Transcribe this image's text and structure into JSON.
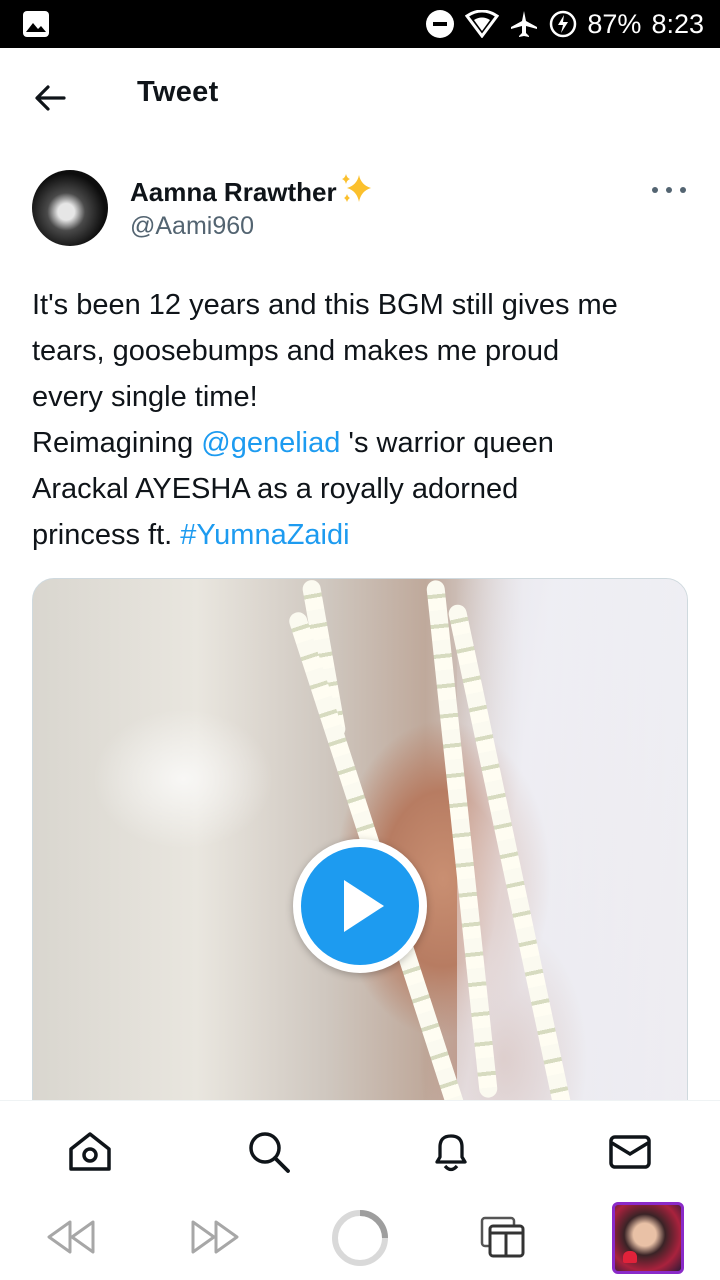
{
  "status_bar": {
    "battery": "87%",
    "time": "8:23",
    "icons": [
      "gallery-icon",
      "do-not-disturb-icon",
      "wifi-icon",
      "airplane-icon",
      "charging-icon"
    ]
  },
  "header": {
    "title": "Tweet",
    "back_icon": "arrow-left-icon"
  },
  "tweet": {
    "author": {
      "name": "Aamna Rrawther",
      "emoji": "✨",
      "handle": "@Aami960"
    },
    "text": {
      "line1": "It's been 12 years and this BGM still gives me",
      "line2": "tears, goosebumps and makes me proud",
      "line3": "every single time!",
      "line4_pre": "Reimagining ",
      "mention": "@geneliad",
      "line4_post": " 's warrior queen",
      "line5": "Arackal AYESHA as a royally adorned",
      "line6_pre": "princess ft. ",
      "hashtag": "#YumnaZaidi"
    },
    "media": {
      "type": "video",
      "play_icon": "play-icon"
    }
  },
  "tab_bar": {
    "items": [
      "home-icon",
      "search-icon",
      "notifications-icon",
      "messages-icon"
    ]
  },
  "browser_nav": {
    "items": [
      "rewind-icon",
      "fast-forward-icon",
      "loading-icon",
      "tabs-icon",
      "profile-thumbnail"
    ]
  },
  "colors": {
    "link": "#1d9bf0",
    "secondary_text": "#536471",
    "play_button": "#1d9bf0",
    "thumbnail_border": "#8a2ac8"
  }
}
